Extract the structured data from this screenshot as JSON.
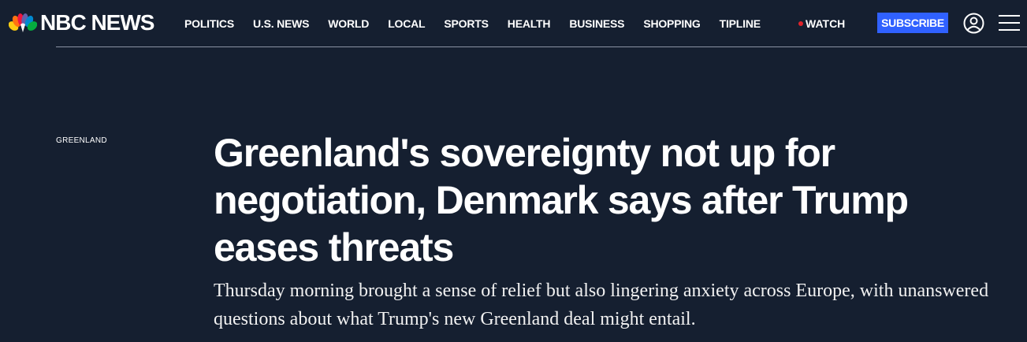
{
  "header": {
    "logo_text": "NBC NEWS",
    "nav_items": [
      {
        "id": "politics",
        "label": "POLITICS"
      },
      {
        "id": "us-news",
        "label": "U.S. NEWS"
      },
      {
        "id": "world",
        "label": "WORLD"
      },
      {
        "id": "local",
        "label": "LOCAL"
      },
      {
        "id": "sports",
        "label": "SPORTS"
      },
      {
        "id": "health",
        "label": "HEALTH"
      },
      {
        "id": "business",
        "label": "BUSINESS"
      },
      {
        "id": "shopping",
        "label": "SHOPPING"
      },
      {
        "id": "tipline",
        "label": "TIPLINE"
      }
    ],
    "watch_label": "WATCH",
    "subscribe_label": "SUBSCRIBE",
    "account_icon": "account-icon",
    "menu_icon": "hamburger-menu-icon"
  },
  "article": {
    "section": "GREENLAND",
    "headline": "Greenland's sovereignty not up for negotiation, Denmark says after Trump eases threats",
    "dek": "Thursday morning brought a sense of relief but also lingering anxiety across Europe, with unanswered questions about what Trump's new Greenland deal might entail."
  },
  "colors": {
    "background": "#151f30",
    "subscribe_button": "#3061ff",
    "watch_dot": "#e1232a",
    "peacock": [
      "#fccc12",
      "#ef1541",
      "#ff7112",
      "#6460aa",
      "#0089d0",
      "#05ac3f"
    ]
  }
}
